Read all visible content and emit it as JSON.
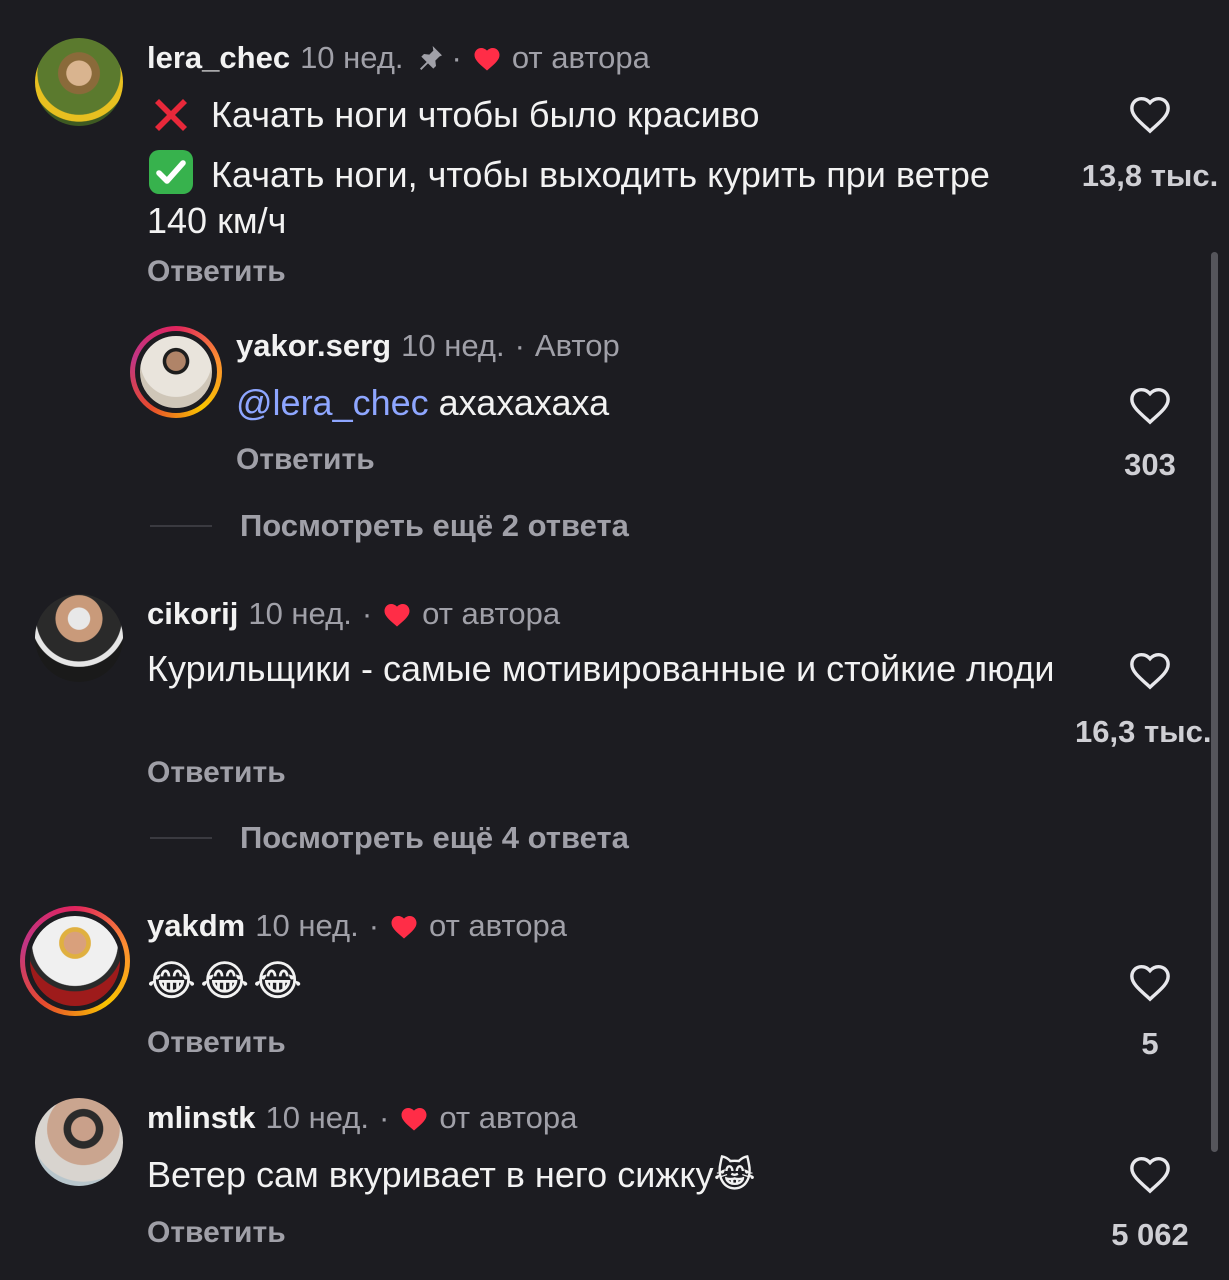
{
  "comments": [
    {
      "username": "lera_chec",
      "time": "10 нед.",
      "sep": "·",
      "author_like": "от автора",
      "line1_icon": "cross-mark-icon",
      "line1": "Качать ноги чтобы было красиво",
      "line2_icon": "check-mark-icon",
      "line2": "Качать ноги, чтобы выходить курить при ветре 140 км/ч",
      "reply": "Ответить",
      "likes": "13,8 тыс.",
      "pinned": true
    },
    {
      "username": "yakor.serg",
      "time": "10 нед.",
      "sep": "·",
      "author_badge": "Автор",
      "mention": "@lera_chec",
      "text": "ахахахаха",
      "reply": "Ответить",
      "likes": "303"
    },
    {
      "more_replies": "Посмотреть ещё 2 ответа"
    },
    {
      "username": "cikorij",
      "time": "10 нед.",
      "sep": "·",
      "author_like": "от автора",
      "text": "Курильщики - самые мотивированные и стойкие люди",
      "reply": "Ответить",
      "likes": "16,3 тыс."
    },
    {
      "more_replies": "Посмотреть ещё 4 ответа"
    },
    {
      "username": "yakdm",
      "time": "10 нед.",
      "sep": "·",
      "author_like": "от автора",
      "text": "😂😂😂",
      "reply": "Ответить",
      "likes": "5"
    },
    {
      "username": "mlinstk",
      "time": "10 нед.",
      "sep": "·",
      "author_like": "от автора",
      "text": "Ветер сам вкуривает в него сижку😹",
      "reply": "Ответить",
      "likes": "5 062"
    }
  ],
  "colors": {
    "background": "#1c1c21",
    "heart_red": "#ff2d47",
    "mention": "#8ea6ff",
    "secondary_text": "#a0a0a8"
  }
}
